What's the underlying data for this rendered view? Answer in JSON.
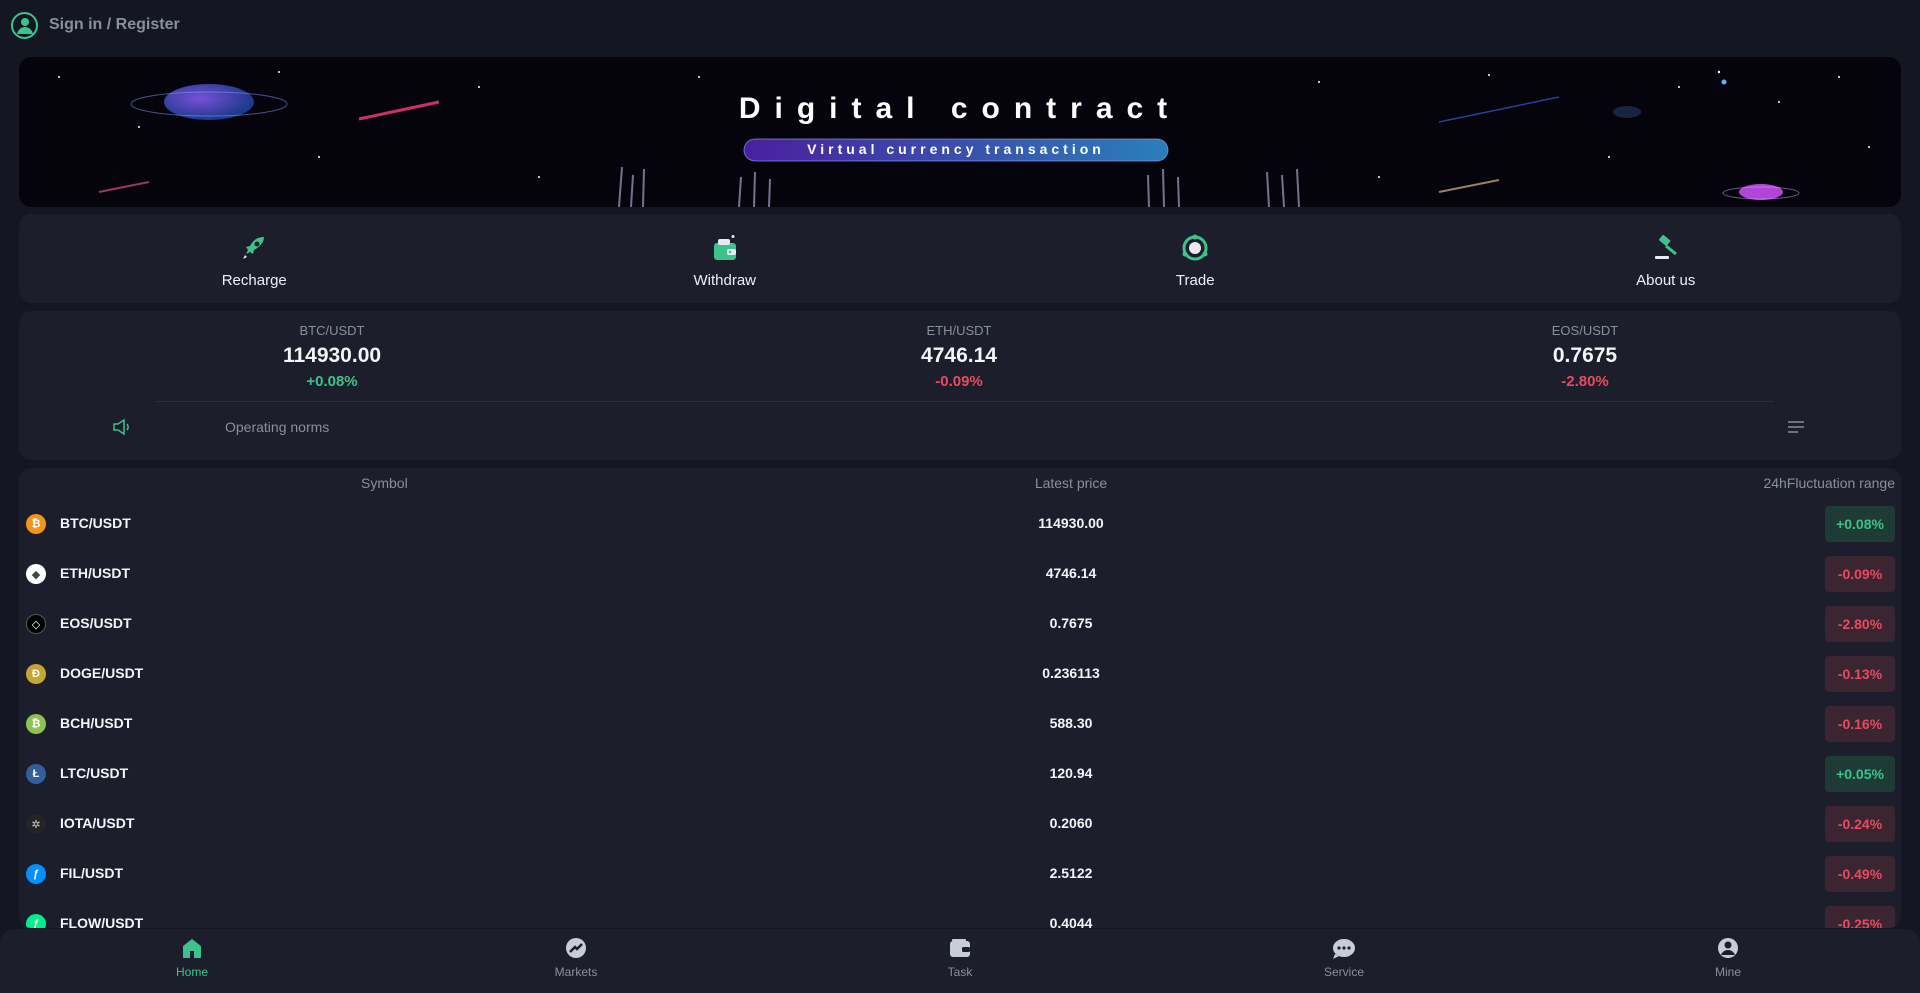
{
  "header": {
    "signin_label": "Sign in / Register"
  },
  "banner": {
    "title": "Digital contract",
    "subtitle": "Virtual currency transaction"
  },
  "shortcuts": [
    {
      "label": "Recharge",
      "icon": "rocket-icon"
    },
    {
      "label": "Withdraw",
      "icon": "wallet-icon"
    },
    {
      "label": "Trade",
      "icon": "trade-icon"
    },
    {
      "label": "About us",
      "icon": "gavel-icon"
    }
  ],
  "tickers": [
    {
      "symbol": "BTC/USDT",
      "price": "114930.00",
      "change": "+0.08%",
      "direction": "up"
    },
    {
      "symbol": "ETH/USDT",
      "price": "4746.14",
      "change": "-0.09%",
      "direction": "down"
    },
    {
      "symbol": "EOS/USDT",
      "price": "0.7675",
      "change": "-2.80%",
      "direction": "down"
    }
  ],
  "notice": {
    "text": "Operating norms"
  },
  "market": {
    "columns": {
      "symbol": "Symbol",
      "price": "Latest price",
      "range": "24hFluctuation range"
    },
    "rows": [
      {
        "symbol": "BTC/USDT",
        "price": "114930.00",
        "change": "+0.08%",
        "direction": "up",
        "icon": "bitcoin-icon",
        "color": "#f2931a"
      },
      {
        "symbol": "ETH/USDT",
        "price": "4746.14",
        "change": "-0.09%",
        "direction": "down",
        "icon": "ethereum-icon",
        "color": "#ffffff"
      },
      {
        "symbol": "EOS/USDT",
        "price": "0.7675",
        "change": "-2.80%",
        "direction": "down",
        "icon": "eos-icon",
        "color": "#000000"
      },
      {
        "symbol": "DOGE/USDT",
        "price": "0.236113",
        "change": "-0.13%",
        "direction": "down",
        "icon": "dogecoin-icon",
        "color": "#c3a634"
      },
      {
        "symbol": "BCH/USDT",
        "price": "588.30",
        "change": "-0.16%",
        "direction": "down",
        "icon": "bitcoin-cash-icon",
        "color": "#8dc351"
      },
      {
        "symbol": "LTC/USDT",
        "price": "120.94",
        "change": "+0.05%",
        "direction": "up",
        "icon": "litecoin-icon",
        "color": "#345d9d"
      },
      {
        "symbol": "IOTA/USDT",
        "price": "0.2060",
        "change": "-0.24%",
        "direction": "down",
        "icon": "iota-icon",
        "color": "#242424"
      },
      {
        "symbol": "FIL/USDT",
        "price": "2.5122",
        "change": "-0.49%",
        "direction": "down",
        "icon": "filecoin-icon",
        "color": "#0090ff"
      },
      {
        "symbol": "FLOW/USDT",
        "price": "0.4044",
        "change": "-0.25%",
        "direction": "down",
        "icon": "flow-icon",
        "color": "#00ef8b"
      }
    ]
  },
  "nav": [
    {
      "label": "Home",
      "icon": "home-icon",
      "active": true
    },
    {
      "label": "Markets",
      "icon": "markets-icon",
      "active": false
    },
    {
      "label": "Task",
      "icon": "task-icon",
      "active": false
    },
    {
      "label": "Service",
      "icon": "service-icon",
      "active": false
    },
    {
      "label": "Mine",
      "icon": "user-icon",
      "active": false
    }
  ],
  "colors": {
    "accent": "#3cc28a",
    "down": "#e84a5f",
    "panel": "#1c1f2b",
    "background": "#141721"
  }
}
